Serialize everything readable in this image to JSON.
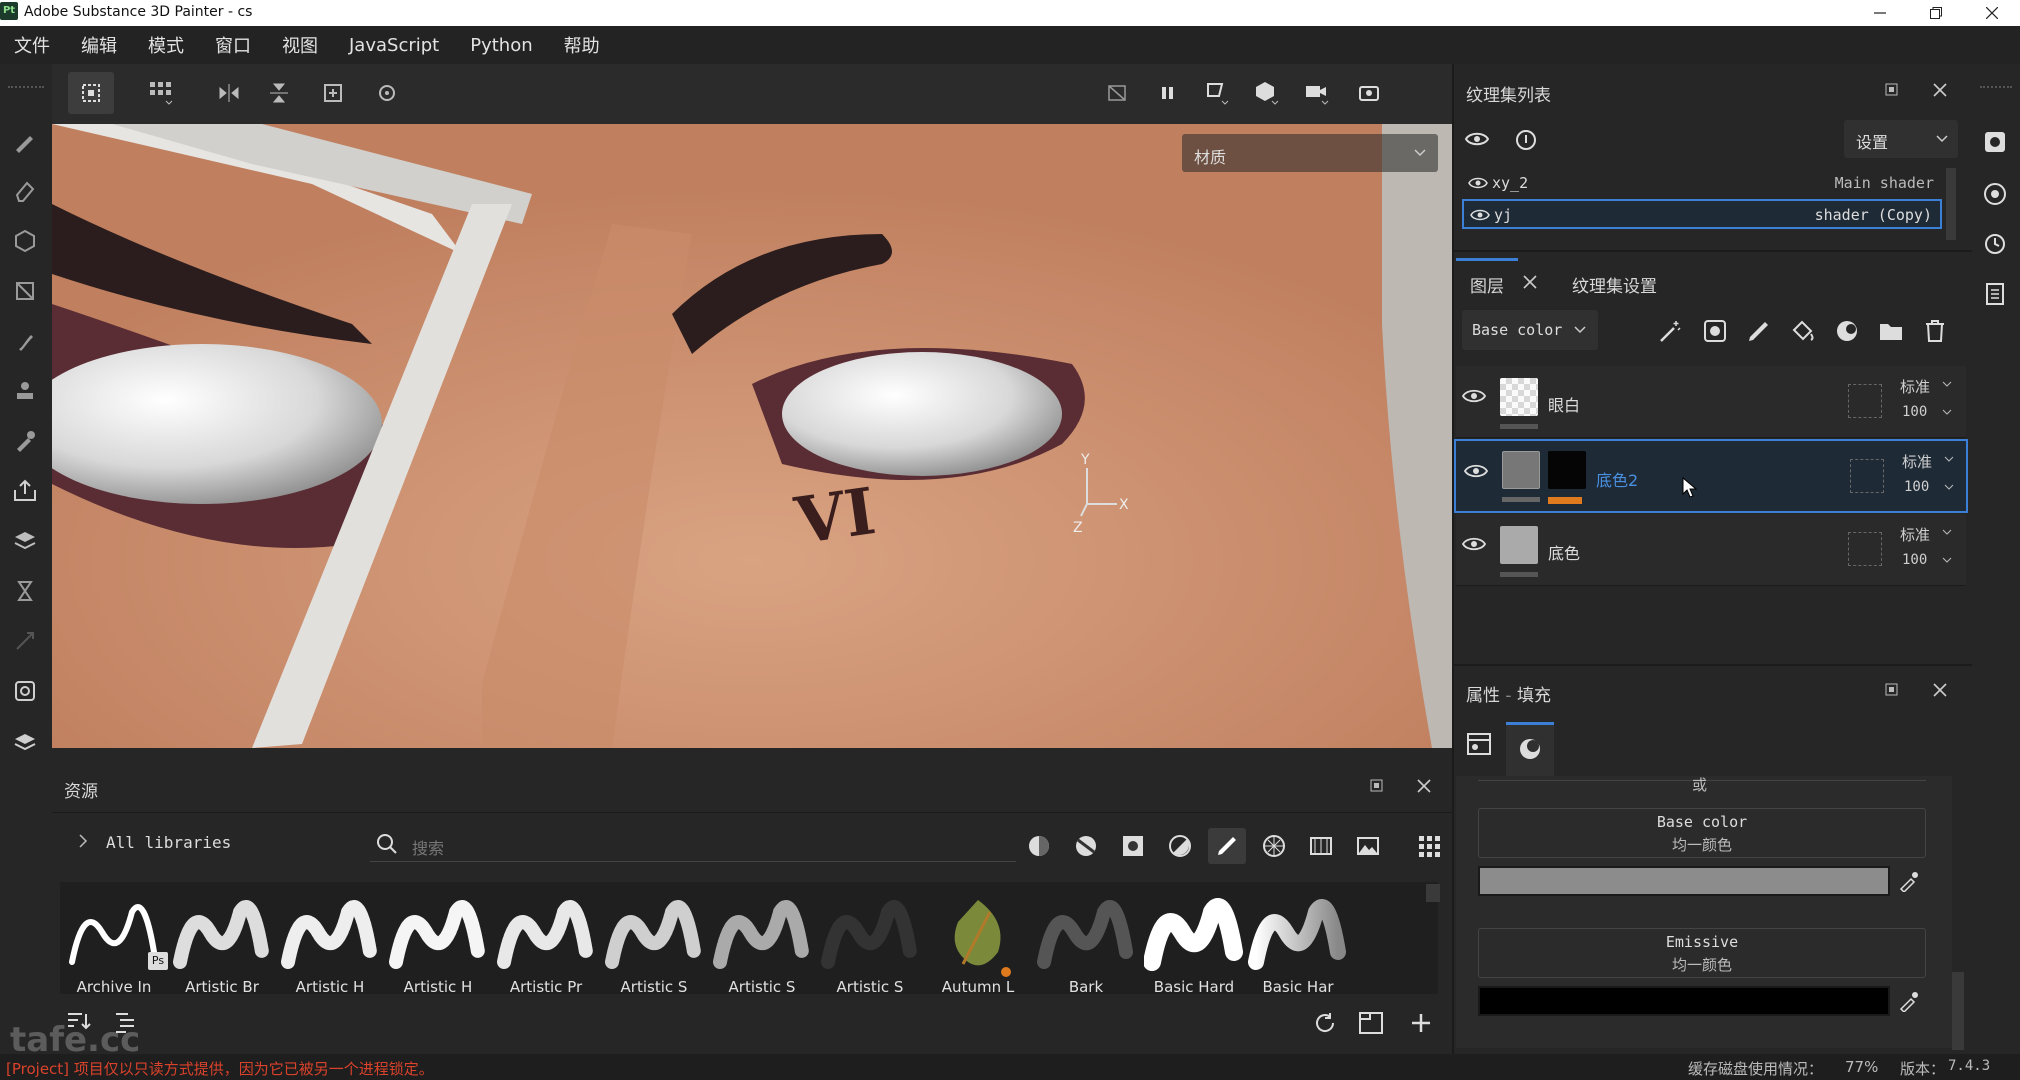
{
  "window": {
    "title": "Adobe Substance 3D Painter - cs",
    "app_badge": "Pt"
  },
  "menu": [
    "文件",
    "编辑",
    "模式",
    "窗口",
    "视图",
    "JavaScript",
    "Python",
    "帮助"
  ],
  "viewport": {
    "material_dropdown": "材质",
    "axis_y": "Y",
    "axis_x": "X",
    "axis_z": "Z",
    "tattoo": "VI"
  },
  "assets": {
    "title": "资源",
    "library": "All libraries",
    "search_placeholder": "搜索",
    "brushes": [
      "Archive In",
      "Artistic Br",
      "Artistic H",
      "Artistic H",
      "Artistic Pr",
      "Artistic S",
      "Artistic S",
      "Artistic S",
      "Autumn L",
      "Bark",
      "Basic Hard",
      "Basic Har"
    ],
    "ps_badge": "Ps"
  },
  "status": {
    "message": "[Project] 项目仅以只读方式提供，因为它已被另一个进程锁定。",
    "disk": "缓存磁盘使用情况：",
    "disk_value": "77%",
    "version_label": "版本：",
    "version": "7.4.3",
    "watermark": "tafe.cc"
  },
  "texture_set_list": {
    "title": "纹理集列表",
    "settings": "设置",
    "items": [
      {
        "name": "xy_2",
        "shader": "Main shader"
      },
      {
        "name": "yj",
        "shader": "shader (Copy)"
      }
    ]
  },
  "layers": {
    "tab_layers": "图层",
    "tab_texture_settings": "纹理集设置",
    "channel": "Base color",
    "items": [
      {
        "name": "眼白",
        "blend": "标准",
        "opacity": "100"
      },
      {
        "name": "底色2",
        "blend": "标准",
        "opacity": "100"
      },
      {
        "name": "底色",
        "blend": "标准",
        "opacity": "100"
      }
    ]
  },
  "properties": {
    "title": "属性",
    "subtitle": "填充",
    "or_label": "或",
    "base_color_label": "Base color",
    "base_color_mode": "均一颜色",
    "emissive_label": "Emissive",
    "emissive_mode": "均一颜色"
  },
  "colors": {
    "accent": "#3b7fd6",
    "selected_layer_text": "#4a90e2",
    "mask_bar": "#e07a1f",
    "status_error": "#d9422b"
  }
}
